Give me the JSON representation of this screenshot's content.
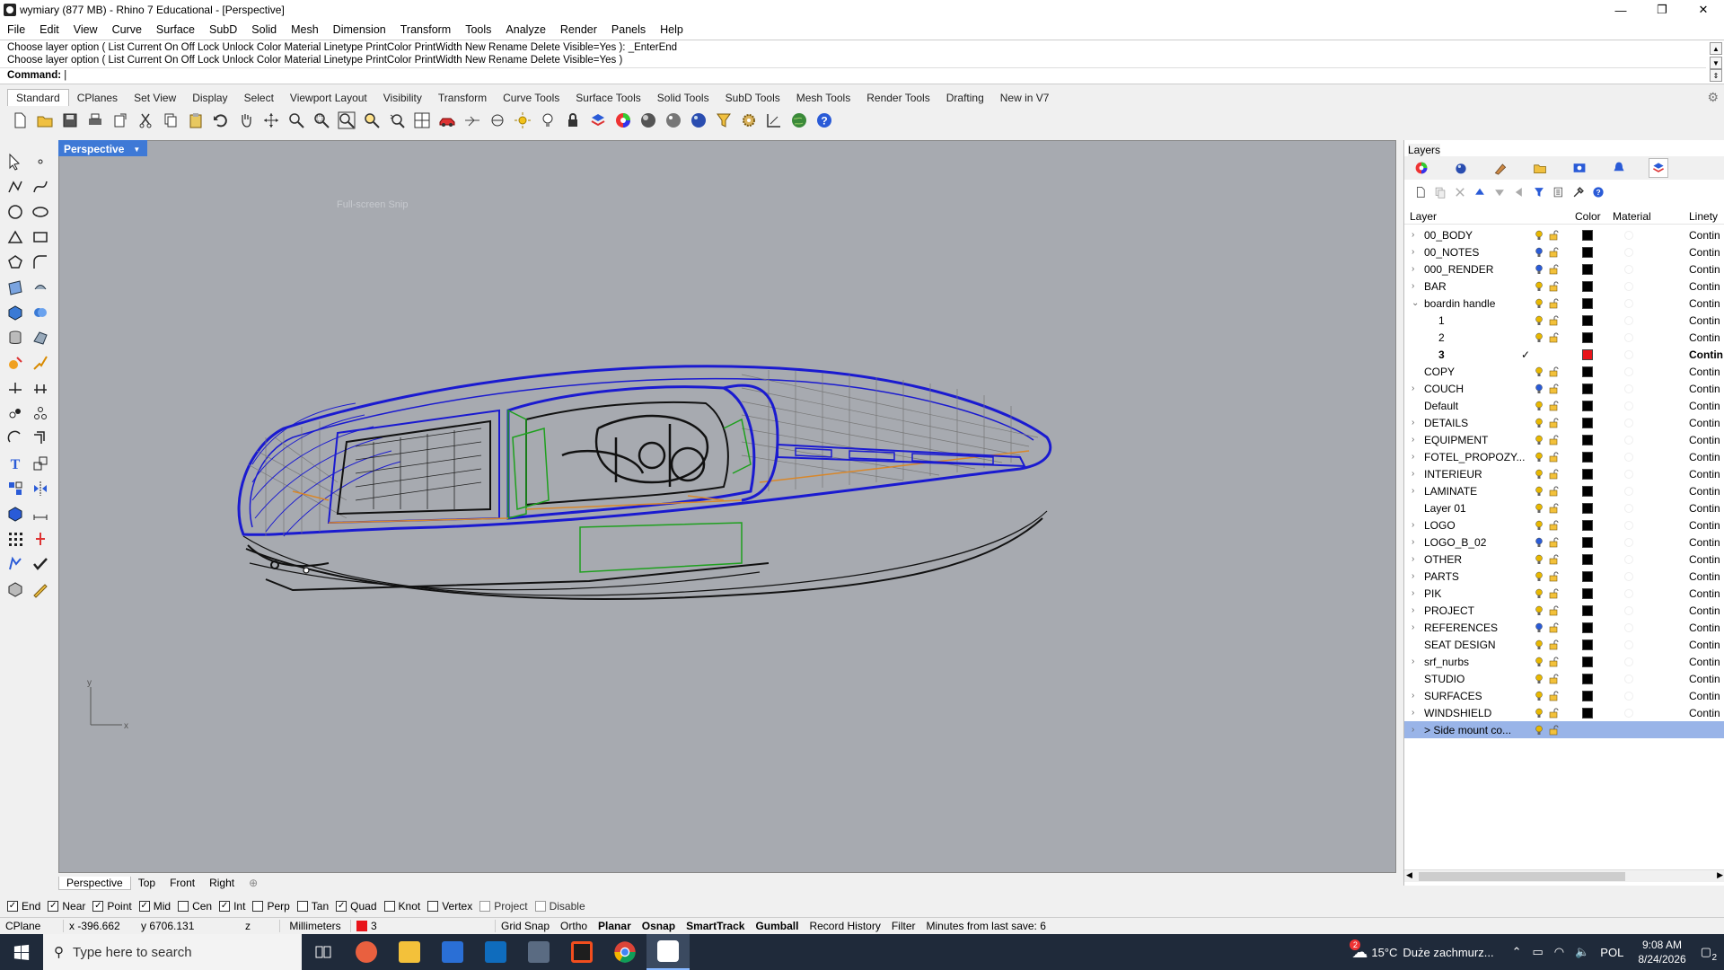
{
  "window": {
    "title": "wymiary (877 MB) - Rhino 7 Educational - [Perspective]",
    "min": "—",
    "restore": "❐",
    "close": "✕"
  },
  "menu": [
    "File",
    "Edit",
    "View",
    "Curve",
    "Surface",
    "SubD",
    "Solid",
    "Mesh",
    "Dimension",
    "Transform",
    "Tools",
    "Analyze",
    "Render",
    "Panels",
    "Help"
  ],
  "command": {
    "history1": "Choose layer option ( List  Current  On  Off  Lock  Unlock  Color  Material  Linetype  PrintColor  PrintWidth  New  Rename  Delete  Visible=Yes ): _EnterEnd",
    "history2": "Choose layer option ( List  Current  On  Off  Lock  Unlock  Color  Material  Linetype  PrintColor  PrintWidth  New  Rename  Delete  Visible=Yes )",
    "prompt": "Command:"
  },
  "toolbar_tabs": [
    "Standard",
    "CPlanes",
    "Set View",
    "Display",
    "Select",
    "Viewport Layout",
    "Visibility",
    "Transform",
    "Curve Tools",
    "Surface Tools",
    "Solid Tools",
    "SubD Tools",
    "Mesh Tools",
    "Render Tools",
    "Drafting",
    "New in V7"
  ],
  "viewport": {
    "label": "Perspective",
    "snip_hint": "Full-screen Snip",
    "axis_y": "y",
    "axis_x": "x"
  },
  "viewport_tabs": [
    "Perspective",
    "Top",
    "Front",
    "Right",
    "⊕"
  ],
  "osnaps": [
    {
      "label": "End",
      "checked": true
    },
    {
      "label": "Near",
      "checked": true
    },
    {
      "label": "Point",
      "checked": true
    },
    {
      "label": "Mid",
      "checked": true
    },
    {
      "label": "Cen",
      "checked": false
    },
    {
      "label": "Int",
      "checked": true
    },
    {
      "label": "Perp",
      "checked": false
    },
    {
      "label": "Tan",
      "checked": false
    },
    {
      "label": "Quad",
      "checked": true
    },
    {
      "label": "Knot",
      "checked": false
    },
    {
      "label": "Vertex",
      "checked": false
    },
    {
      "label": "Project",
      "checked": false
    },
    {
      "label": "Disable",
      "checked": false
    }
  ],
  "status": {
    "cplane": "CPlane",
    "x": "x -396.662",
    "y": "y 6706.131",
    "z": "z",
    "units": "Millimeters",
    "layer": "3",
    "layer_color": "#e8141a",
    "grid_snap": "Grid Snap",
    "ortho": "Ortho",
    "planar": "Planar",
    "osnap": "Osnap",
    "smarttrack": "SmartTrack",
    "gumball": "Gumball",
    "record_history": "Record History",
    "filter": "Filter",
    "minutes": "Minutes from last save: 6"
  },
  "layers_panel": {
    "title": "Layers",
    "headers": {
      "layer": "Layer",
      "color": "Color",
      "material": "Material",
      "linetype": "Linety"
    },
    "rows": [
      {
        "name": "00_BODY",
        "expand": "›",
        "bulb": "#e8b800",
        "color": "#000000",
        "linetype": "Contin"
      },
      {
        "name": "00_NOTES",
        "expand": "›",
        "bulb": "#2a5bd7",
        "color": "#000000",
        "linetype": "Contin"
      },
      {
        "name": "000_RENDER",
        "expand": "›",
        "bulb": "#2a5bd7",
        "color": "#000000",
        "linetype": "Contin"
      },
      {
        "name": "BAR",
        "expand": "›",
        "bulb": "#e8b800",
        "color": "#000000",
        "linetype": "Contin"
      },
      {
        "name": "boardin handle",
        "expand": "⌄",
        "bulb": "#e8b800",
        "color": "#000000",
        "linetype": "Contin"
      },
      {
        "name": "1",
        "expand": "",
        "child": true,
        "bulb": "#e8b800",
        "color": "#000000",
        "linetype": "Contin"
      },
      {
        "name": "2",
        "expand": "",
        "child": true,
        "bulb": "#e8b800",
        "color": "#000000",
        "linetype": "Contin"
      },
      {
        "name": "3",
        "expand": "",
        "child": true,
        "current": true,
        "color": "#e8141a",
        "linetype": "Contin"
      },
      {
        "name": "COPY",
        "expand": "",
        "bulb": "#e8b800",
        "color": "#000000",
        "linetype": "Contin"
      },
      {
        "name": "COUCH",
        "expand": "›",
        "bulb": "#2a5bd7",
        "color": "#000000",
        "linetype": "Contin"
      },
      {
        "name": "Default",
        "expand": "",
        "bulb": "#e8b800",
        "color": "#000000",
        "linetype": "Contin"
      },
      {
        "name": "DETAILS",
        "expand": "›",
        "bulb": "#e8b800",
        "color": "#000000",
        "linetype": "Contin"
      },
      {
        "name": "EQUIPMENT",
        "expand": "›",
        "bulb": "#e8b800",
        "color": "#000000",
        "linetype": "Contin"
      },
      {
        "name": "FOTEL_PROPOZY...",
        "expand": "›",
        "bulb": "#e8b800",
        "color": "#000000",
        "linetype": "Contin"
      },
      {
        "name": "INTERIEUR",
        "expand": "›",
        "bulb": "#e8b800",
        "color": "#000000",
        "linetype": "Contin"
      },
      {
        "name": "LAMINATE",
        "expand": "›",
        "bulb": "#e8b800",
        "color": "#000000",
        "linetype": "Contin"
      },
      {
        "name": "Layer 01",
        "expand": "",
        "bulb": "#e8b800",
        "color": "#000000",
        "linetype": "Contin"
      },
      {
        "name": "LOGO",
        "expand": "›",
        "bulb": "#e8b800",
        "color": "#000000",
        "linetype": "Contin"
      },
      {
        "name": "LOGO_B_02",
        "expand": "›",
        "bulb": "#2a5bd7",
        "color": "#000000",
        "linetype": "Contin"
      },
      {
        "name": "OTHER",
        "expand": "›",
        "bulb": "#e8b800",
        "color": "#000000",
        "linetype": "Contin"
      },
      {
        "name": "PARTS",
        "expand": "›",
        "bulb": "#e8b800",
        "color": "#000000",
        "linetype": "Contin"
      },
      {
        "name": "PIK",
        "expand": "›",
        "bulb": "#e8b800",
        "color": "#000000",
        "linetype": "Contin"
      },
      {
        "name": "PROJECT",
        "expand": "›",
        "bulb": "#e8b800",
        "color": "#000000",
        "linetype": "Contin"
      },
      {
        "name": "REFERENCES",
        "expand": "›",
        "bulb": "#2a5bd7",
        "color": "#000000",
        "linetype": "Contin"
      },
      {
        "name": "SEAT DESIGN",
        "expand": "",
        "bulb": "#e8b800",
        "color": "#000000",
        "linetype": "Contin"
      },
      {
        "name": "srf_nurbs",
        "expand": "›",
        "bulb": "#e8b800",
        "color": "#000000",
        "linetype": "Contin"
      },
      {
        "name": "STUDIO",
        "expand": "",
        "bulb": "#e8b800",
        "color": "#000000",
        "linetype": "Contin"
      },
      {
        "name": "SURFACES",
        "expand": "›",
        "bulb": "#e8b800",
        "color": "#000000",
        "linetype": "Contin"
      },
      {
        "name": "WINDSHIELD",
        "expand": "›",
        "bulb": "#e8b800",
        "color": "#000000",
        "linetype": "Contin"
      },
      {
        "name": "> Side mount co...",
        "expand": "›",
        "bulb": "#e8b800",
        "selected": true,
        "color": "",
        "linetype": ""
      }
    ]
  },
  "taskbar": {
    "search_placeholder": "Type here to search",
    "weather_temp": "15°C",
    "weather_text": "Duże zachmurz...",
    "weather_badge": "2",
    "lang": "POL",
    "time": "9:08 AM",
    "date": "8/24/2026",
    "notif_count": "2"
  }
}
